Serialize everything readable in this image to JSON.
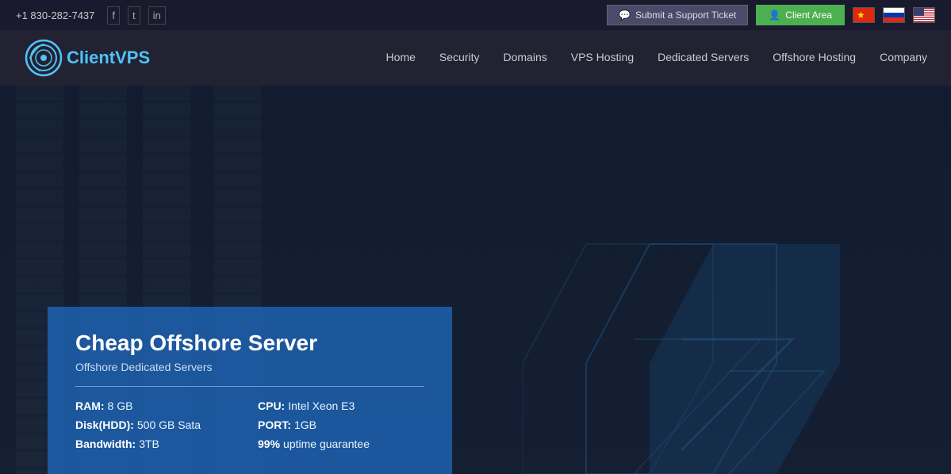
{
  "topbar": {
    "phone": "+1 830-282-7437",
    "social": [
      "f",
      "t",
      "in"
    ],
    "support_btn": "Submit a Support Ticket",
    "client_btn": "Client Area",
    "flags": [
      "cn",
      "ru",
      "us"
    ]
  },
  "nav": {
    "logo_brand": "ClientVPS",
    "logo_prefix": "Client",
    "logo_suffix": "VPS",
    "links": [
      {
        "label": "Home",
        "id": "home"
      },
      {
        "label": "Security",
        "id": "security"
      },
      {
        "label": "Domains",
        "id": "domains"
      },
      {
        "label": "VPS Hosting",
        "id": "vps-hosting"
      },
      {
        "label": "Dedicated Servers",
        "id": "dedicated-servers"
      },
      {
        "label": "Offshore Hosting",
        "id": "offshore-hosting"
      },
      {
        "label": "Company",
        "id": "company"
      }
    ]
  },
  "hero": {
    "card": {
      "title": "Cheap Offshore Server",
      "subtitle": "Offshore Dedicated Servers",
      "specs": [
        {
          "label": "RAM:",
          "value": "8 GB"
        },
        {
          "label": "CPU:",
          "value": "Intel Xeon E3"
        },
        {
          "label": "Disk(HDD):",
          "value": "500 GB Sata"
        },
        {
          "label": "PORT:",
          "value": "1GB"
        },
        {
          "label": "Bandwidth:",
          "value": "3TB"
        },
        {
          "label": "99%",
          "value": "uptime guarantee",
          "bold_value": true
        }
      ]
    }
  }
}
